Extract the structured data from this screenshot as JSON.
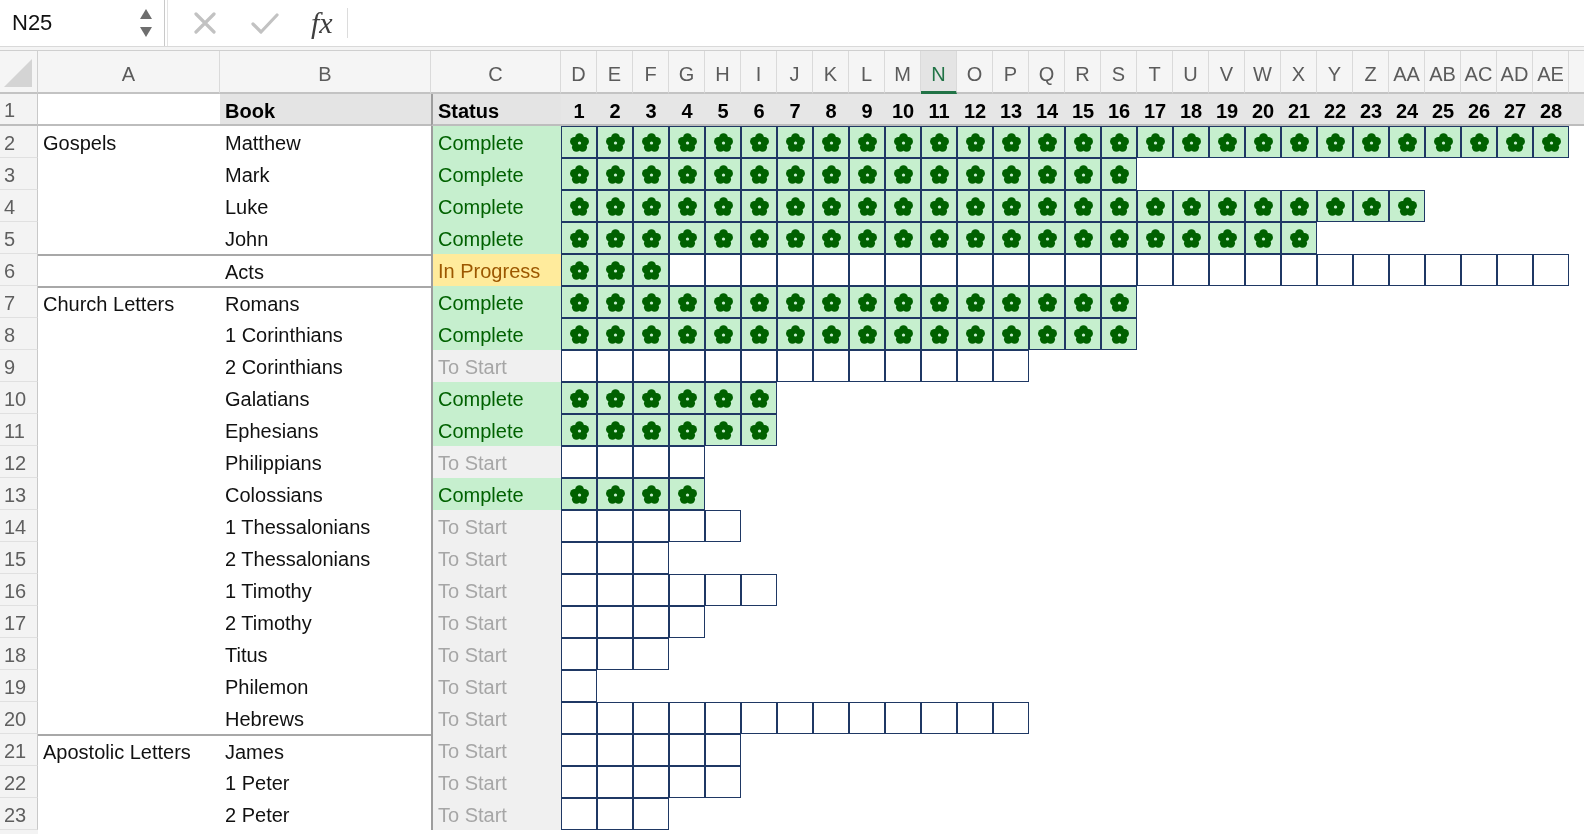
{
  "name_box": {
    "value": "N25"
  },
  "formula_bar": {
    "function_label": "fx"
  },
  "columns": [
    {
      "label": "A",
      "selected": false
    },
    {
      "label": "B",
      "selected": false
    },
    {
      "label": "C",
      "selected": false
    },
    {
      "label": "D",
      "selected": false
    },
    {
      "label": "E",
      "selected": false
    },
    {
      "label": "F",
      "selected": false
    },
    {
      "label": "G",
      "selected": false
    },
    {
      "label": "H",
      "selected": false
    },
    {
      "label": "I",
      "selected": false
    },
    {
      "label": "J",
      "selected": false
    },
    {
      "label": "K",
      "selected": false
    },
    {
      "label": "L",
      "selected": false
    },
    {
      "label": "M",
      "selected": false
    },
    {
      "label": "N",
      "selected": true
    },
    {
      "label": "O",
      "selected": false
    },
    {
      "label": "P",
      "selected": false
    },
    {
      "label": "Q",
      "selected": false
    },
    {
      "label": "R",
      "selected": false
    },
    {
      "label": "S",
      "selected": false
    },
    {
      "label": "T",
      "selected": false
    },
    {
      "label": "U",
      "selected": false
    },
    {
      "label": "V",
      "selected": false
    },
    {
      "label": "W",
      "selected": false
    },
    {
      "label": "X",
      "selected": false
    },
    {
      "label": "Y",
      "selected": false
    },
    {
      "label": "Z",
      "selected": false
    },
    {
      "label": "AA",
      "selected": false
    },
    {
      "label": "AB",
      "selected": false
    },
    {
      "label": "AC",
      "selected": false
    },
    {
      "label": "AD",
      "selected": false
    },
    {
      "label": "AE",
      "selected": false
    }
  ],
  "header_row": {
    "row": "1",
    "book": "Book",
    "status": "Status",
    "chapters": [
      "1",
      "2",
      "3",
      "4",
      "5",
      "6",
      "7",
      "8",
      "9",
      "10",
      "11",
      "12",
      "13",
      "14",
      "15",
      "16",
      "17",
      "18",
      "19",
      "20",
      "21",
      "22",
      "23",
      "24",
      "25",
      "26",
      "27",
      "28"
    ]
  },
  "groups": [
    {
      "name": "Gospels",
      "books": [
        {
          "row": "2",
          "title": "Matthew",
          "status": {
            "kind": "complete",
            "label": "Complete"
          },
          "chapters": [
            true,
            true,
            true,
            true,
            true,
            true,
            true,
            true,
            true,
            true,
            true,
            true,
            true,
            true,
            true,
            true,
            true,
            true,
            true,
            true,
            true,
            true,
            true,
            true,
            true,
            true,
            true,
            true
          ]
        },
        {
          "row": "3",
          "title": "Mark",
          "status": {
            "kind": "complete",
            "label": "Complete"
          },
          "chapters": [
            true,
            true,
            true,
            true,
            true,
            true,
            true,
            true,
            true,
            true,
            true,
            true,
            true,
            true,
            true,
            true
          ]
        },
        {
          "row": "4",
          "title": "Luke",
          "status": {
            "kind": "complete",
            "label": "Complete"
          },
          "chapters": [
            true,
            true,
            true,
            true,
            true,
            true,
            true,
            true,
            true,
            true,
            true,
            true,
            true,
            true,
            true,
            true,
            true,
            true,
            true,
            true,
            true,
            true,
            true,
            true
          ]
        },
        {
          "row": "5",
          "title": "John",
          "status": {
            "kind": "complete",
            "label": "Complete"
          },
          "chapters": [
            true,
            true,
            true,
            true,
            true,
            true,
            true,
            true,
            true,
            true,
            true,
            true,
            true,
            true,
            true,
            true,
            true,
            true,
            true,
            true,
            true
          ]
        }
      ]
    },
    {
      "books": [
        {
          "row": "6",
          "title": "Acts",
          "status": {
            "kind": "in_progress",
            "label": "In Progress"
          },
          "chapters": [
            true,
            true,
            true,
            false,
            false,
            false,
            false,
            false,
            false,
            false,
            false,
            false,
            false,
            false,
            false,
            false,
            false,
            false,
            false,
            false,
            false,
            false,
            false,
            false,
            false,
            false,
            false,
            false
          ]
        }
      ]
    },
    {
      "name": "Church Letters",
      "books": [
        {
          "row": "7",
          "title": "Romans",
          "status": {
            "kind": "complete",
            "label": "Complete"
          },
          "chapters": [
            true,
            true,
            true,
            true,
            true,
            true,
            true,
            true,
            true,
            true,
            true,
            true,
            true,
            true,
            true,
            true
          ]
        },
        {
          "row": "8",
          "title": "1 Corinthians",
          "status": {
            "kind": "complete",
            "label": "Complete"
          },
          "chapters": [
            true,
            true,
            true,
            true,
            true,
            true,
            true,
            true,
            true,
            true,
            true,
            true,
            true,
            true,
            true,
            true
          ]
        },
        {
          "row": "9",
          "title": "2 Corinthians",
          "status": {
            "kind": "not_started",
            "label": "To Start"
          },
          "chapters": [
            false,
            false,
            false,
            false,
            false,
            false,
            false,
            false,
            false,
            false,
            false,
            false,
            false
          ]
        },
        {
          "row": "10",
          "title": "Galatians",
          "status": {
            "kind": "complete",
            "label": "Complete"
          },
          "chapters": [
            true,
            true,
            true,
            true,
            true,
            true
          ]
        },
        {
          "row": "11",
          "title": "Ephesians",
          "status": {
            "kind": "complete",
            "label": "Complete"
          },
          "chapters": [
            true,
            true,
            true,
            true,
            true,
            true
          ]
        },
        {
          "row": "12",
          "title": "Philippians",
          "status": {
            "kind": "not_started",
            "label": "To Start"
          },
          "chapters": [
            false,
            false,
            false,
            false
          ]
        },
        {
          "row": "13",
          "title": "Colossians",
          "status": {
            "kind": "complete",
            "label": "Complete"
          },
          "chapters": [
            true,
            true,
            true,
            true
          ]
        },
        {
          "row": "14",
          "title": "1 Thessalonians",
          "status": {
            "kind": "not_started",
            "label": "To Start"
          },
          "chapters": [
            false,
            false,
            false,
            false,
            false
          ]
        },
        {
          "row": "15",
          "title": "2 Thessalonians",
          "status": {
            "kind": "not_started",
            "label": "To Start"
          },
          "chapters": [
            false,
            false,
            false
          ]
        },
        {
          "row": "16",
          "title": "1 Timothy",
          "status": {
            "kind": "not_started",
            "label": "To Start"
          },
          "chapters": [
            false,
            false,
            false,
            false,
            false,
            false
          ]
        },
        {
          "row": "17",
          "title": "2 Timothy",
          "status": {
            "kind": "not_started",
            "label": "To Start"
          },
          "chapters": [
            false,
            false,
            false,
            false
          ]
        },
        {
          "row": "18",
          "title": "Titus",
          "status": {
            "kind": "not_started",
            "label": "To Start"
          },
          "chapters": [
            false,
            false,
            false
          ]
        },
        {
          "row": "19",
          "title": "Philemon",
          "status": {
            "kind": "not_started",
            "label": "To Start"
          },
          "chapters": [
            false
          ]
        },
        {
          "row": "20",
          "title": "Hebrews",
          "status": {
            "kind": "not_started",
            "label": "To Start"
          },
          "chapters": [
            false,
            false,
            false,
            false,
            false,
            false,
            false,
            false,
            false,
            false,
            false,
            false,
            false
          ]
        }
      ]
    },
    {
      "name": "Apostolic Letters",
      "books": [
        {
          "row": "21",
          "title": "James",
          "status": {
            "kind": "not_started",
            "label": "To Start"
          },
          "chapters": [
            false,
            false,
            false,
            false,
            false
          ]
        },
        {
          "row": "22",
          "title": "1 Peter",
          "status": {
            "kind": "not_started",
            "label": "To Start"
          },
          "chapters": [
            false,
            false,
            false,
            false,
            false
          ]
        },
        {
          "row": "23",
          "title": "2 Peter",
          "status": {
            "kind": "not_started",
            "label": "To Start"
          },
          "chapters": [
            false,
            false,
            false
          ]
        }
      ]
    }
  ]
}
